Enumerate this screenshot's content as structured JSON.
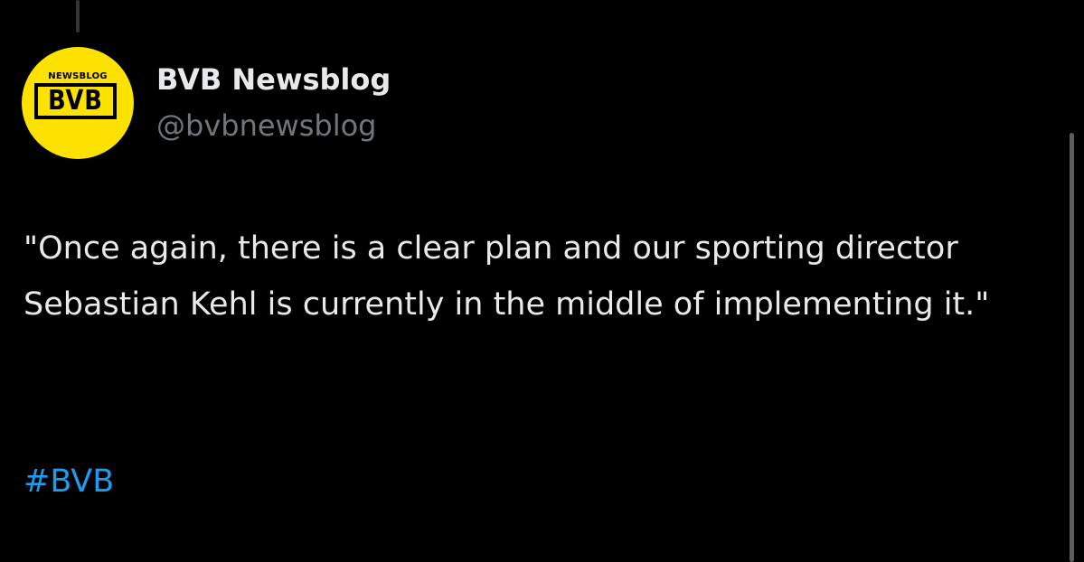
{
  "tweet": {
    "author": {
      "display_name": "BVB Newsblog",
      "handle": "@bvbnewsblog",
      "avatar": {
        "top_text": "NEWSBLOG",
        "main_text": "BVB",
        "background_color": "#fde100"
      }
    },
    "text": "\"Once again, there is a clear plan and our sporting director Sebastian Kehl is currently in the middle of implementing it.\"",
    "hashtag": "#BVB"
  },
  "colors": {
    "background": "#000000",
    "primary_text": "#e7e9ea",
    "secondary_text": "#71767b",
    "link": "#1d9bf0"
  }
}
